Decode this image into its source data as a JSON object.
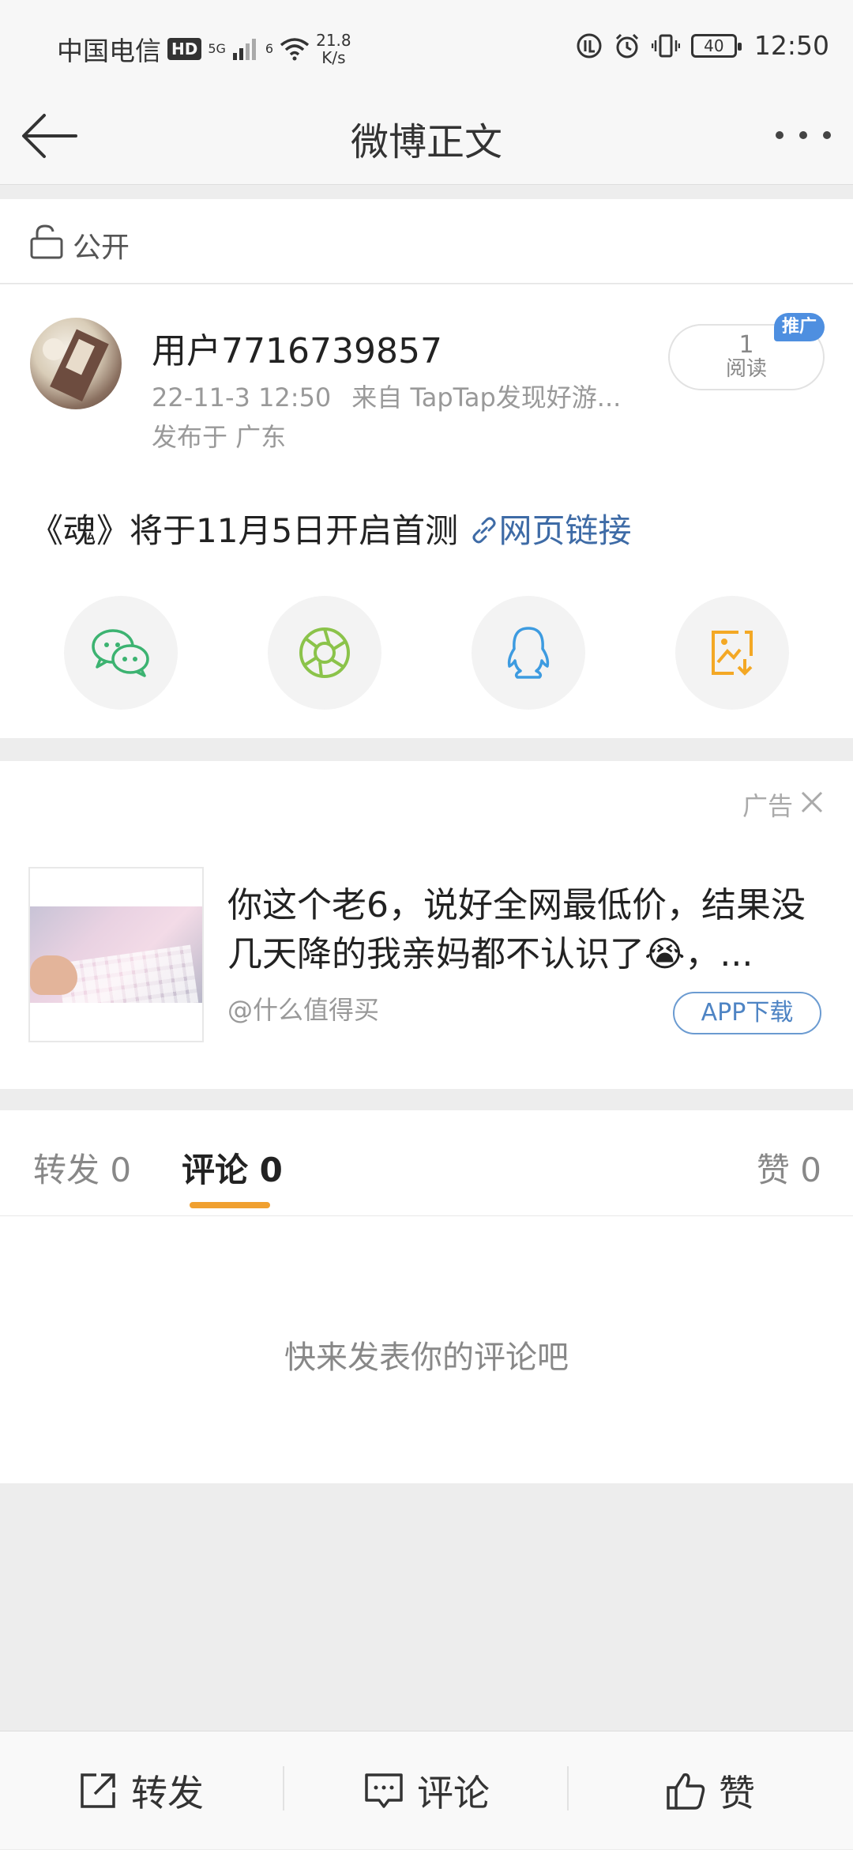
{
  "status_bar": {
    "carrier": "中国电信",
    "hd": "HD",
    "network": "5G",
    "wifi_gen": "6",
    "speed_value": "21.8",
    "speed_unit": "K/s",
    "battery": "40",
    "time": "12:50"
  },
  "navbar": {
    "title": "微博正文"
  },
  "visibility": {
    "label": "公开"
  },
  "post": {
    "username": "用户7716739857",
    "timestamp": "22-11-3 12:50",
    "source": "来自 TapTap发现好游...",
    "location": "发布于 广东",
    "read_count": "1",
    "read_label": "阅读",
    "promo_badge": "推广",
    "text": "《魂》将于11月5日开启首测",
    "link_text": "网页链接"
  },
  "share": {
    "icons": [
      "wechat-icon",
      "moments-icon",
      "qq-icon",
      "save-image-icon"
    ],
    "colors": {
      "wechat": "#3cb371",
      "moments": "#8bc34a",
      "qq": "#3d9be0",
      "save": "#f3a825"
    }
  },
  "ad": {
    "label": "广告",
    "text": "你这个老6，说好全网最低价，结果没几天降的我亲妈都不认识了😭，...",
    "source": "@什么值得买",
    "cta": "APP下载"
  },
  "tabs": {
    "repost": "转发 0",
    "comment": "评论 0",
    "like": "赞 0",
    "active": "comment",
    "accent_color": "#f0a030"
  },
  "comments": {
    "empty_text": "快来发表你的评论吧"
  },
  "bottom_bar": {
    "repost": "转发",
    "comment": "评论",
    "like": "赞"
  }
}
